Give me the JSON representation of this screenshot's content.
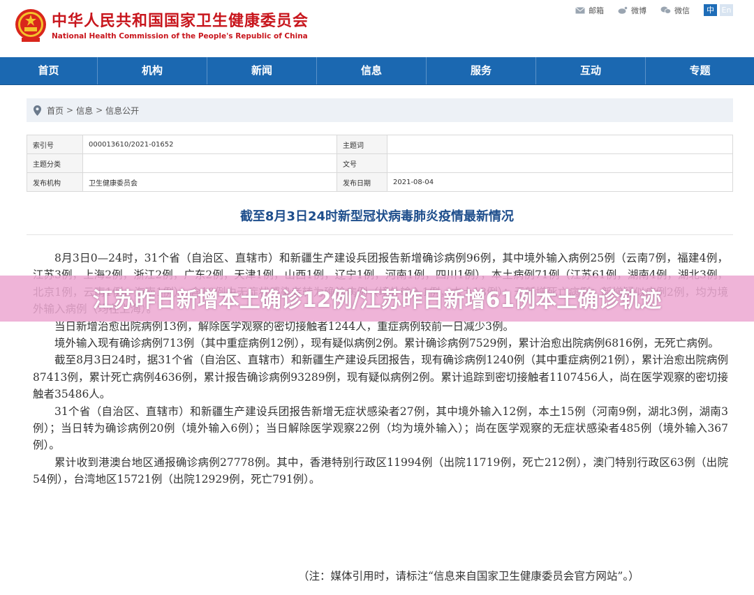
{
  "header": {
    "title_cn": "中华人民共和国国家卫生健康委员会",
    "title_en": "National Health Commission of the People's Republic of China",
    "links": [
      {
        "label": "邮箱",
        "icon": "mail-icon"
      },
      {
        "label": "微博",
        "icon": "weibo-icon"
      },
      {
        "label": "微信",
        "icon": "wechat-icon"
      }
    ],
    "lang_cn": "中",
    "lang_en": "En"
  },
  "nav": {
    "items": [
      "首页",
      "机构",
      "新闻",
      "信息",
      "服务",
      "互动",
      "专题"
    ]
  },
  "breadcrumb": [
    "首页",
    "信息",
    "信息公开"
  ],
  "breadcrumb_sep": ">",
  "meta": {
    "index_label": "索引号",
    "index_value": "000013610/2021-01652",
    "subject_label": "主题词",
    "subject_value": "",
    "category_label": "主题分类",
    "category_value": "",
    "doc_label": "文号",
    "doc_value": "",
    "org_label": "发布机构",
    "org_value": "卫生健康委员会",
    "date_label": "发布日期",
    "date_value": "2021-08-04"
  },
  "article": {
    "title": "截至8月3日24时新型冠状病毒肺炎疫情最新情况",
    "paragraphs": [
      "8月3日0—24时，31个省（自治区、直辖市）和新疆生产建设兵团报告新增确诊病例96例，其中境外输入病例25例（云南7例，福建4例，江苏3例，上海2例，浙江2例，广东2例，天津1例，山西1例，辽宁1例，河南1例，四川1例），本土病例71例（江苏61例，湖南4例，湖北3例，北京1例，云南1例，海南1例），含19例由无症状感染者转为确诊病例（境外输入1例，本土18例）；无新增死亡病例；新增疑似病例2例，均为境外输入病例（均在上海）。",
      "当日新增治愈出院病例13例，解除医学观察的密切接触者1244人，重症病例较前一日减少3例。",
      "境外输入现有确诊病例713例（其中重症病例12例），现有疑似病例2例。累计确诊病例7529例，累计治愈出院病例6816例，无死亡病例。",
      "截至8月3日24时，据31个省（自治区、直辖市）和新疆生产建设兵团报告，现有确诊病例1240例（其中重症病例21例），累计治愈出院病例87413例，累计死亡病例4636例，累计报告确诊病例93289例，现有疑似病例2例。累计追踪到密切接触者1107456人，尚在医学观察的密切接触者35486人。",
      "31个省（自治区、直辖市）和新疆生产建设兵团报告新增无症状感染者27例，其中境外输入12例，本土15例（河南9例，湖北3例，湖南3例）；当日转为确诊病例20例（境外输入6例）；当日解除医学观察22例（均为境外输入）；尚在医学观察的无症状感染者485例（境外输入367例）。",
      "累计收到港澳台地区通报确诊病例27778例。其中，香港特别行政区11994例（出院11719例，死亡212例），澳门特别行政区63例（出院54例），台湾地区15721例（出院12929例，死亡791例）。"
    ],
    "note": "（注：媒体引用时，请标注“信息来自国家卫生健康委员会官方网站”。）"
  },
  "overlay": {
    "text": "江苏昨日新增本土确诊12例/江苏昨日新增61例本土确诊轨迹"
  }
}
